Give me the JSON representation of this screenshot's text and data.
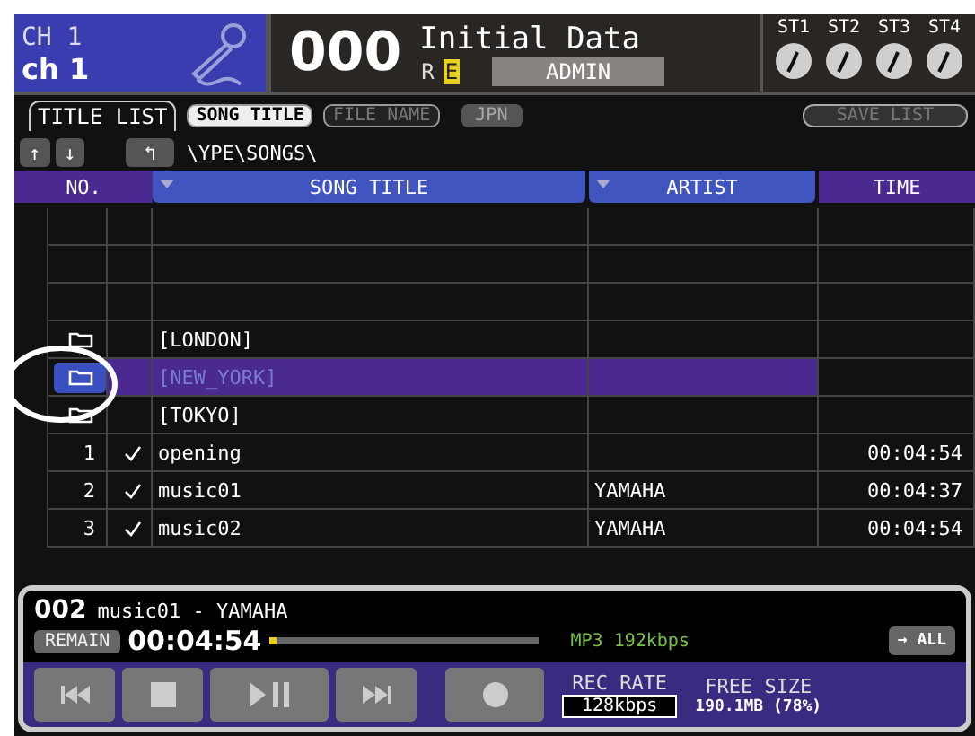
{
  "channel": {
    "number": "CH 1",
    "name": "ch 1"
  },
  "scene": {
    "number": "000",
    "title": "Initial Data",
    "flags": [
      {
        "label": "R",
        "on": false
      },
      {
        "label": "E",
        "on": true
      }
    ],
    "user": "ADMIN"
  },
  "stereo_knobs": [
    {
      "label": "ST1"
    },
    {
      "label": "ST2"
    },
    {
      "label": "ST3"
    },
    {
      "label": "ST4"
    }
  ],
  "tabs": [
    {
      "label": "TITLE LIST",
      "selected": true
    }
  ],
  "display_options": [
    {
      "label": "SONG TITLE",
      "selected": true
    },
    {
      "label": "FILE NAME",
      "selected": false
    }
  ],
  "jpn_button": "JPN",
  "save_button": {
    "label": "SAVE LIST",
    "disabled": true
  },
  "nav": {
    "up": "↑",
    "down": "↓",
    "parent": "↰",
    "path": "\\YPE\\SONGS\\"
  },
  "columns": [
    "NO.",
    "SONG TITLE",
    "ARTIST",
    "TIME"
  ],
  "rows": [
    {
      "kind": "empty"
    },
    {
      "kind": "empty"
    },
    {
      "kind": "empty"
    },
    {
      "kind": "folder",
      "title": "[LONDON]",
      "selected": false
    },
    {
      "kind": "folder",
      "title": "[NEW_YORK]",
      "selected": true
    },
    {
      "kind": "folder",
      "title": "[TOKYO]",
      "selected": false
    },
    {
      "kind": "song",
      "no": "1",
      "checked": true,
      "title": "opening",
      "artist": "",
      "time": "00:04:54"
    },
    {
      "kind": "song",
      "no": "2",
      "checked": true,
      "title": "music01",
      "artist": "YAMAHA",
      "time": "00:04:37"
    },
    {
      "kind": "song",
      "no": "3",
      "checked": true,
      "title": "music02",
      "artist": "YAMAHA",
      "time": "00:04:54"
    }
  ],
  "player": {
    "track": "002",
    "now_playing": "music01 - YAMAHA",
    "mode": "REMAIN",
    "time": "00:04:54",
    "level": 0.02,
    "format": "MP3 192kbps",
    "repeat": "→ ALL"
  },
  "transport": [
    {
      "kind": "prev"
    },
    {
      "kind": "stop"
    },
    {
      "kind": "play"
    },
    {
      "kind": "next"
    },
    {
      "kind": "rec"
    }
  ],
  "rec_rate": {
    "label": "REC RATE",
    "value": "128kbps"
  },
  "free_size": {
    "label": "FREE SIZE",
    "value": "190.1MB (78%)"
  }
}
